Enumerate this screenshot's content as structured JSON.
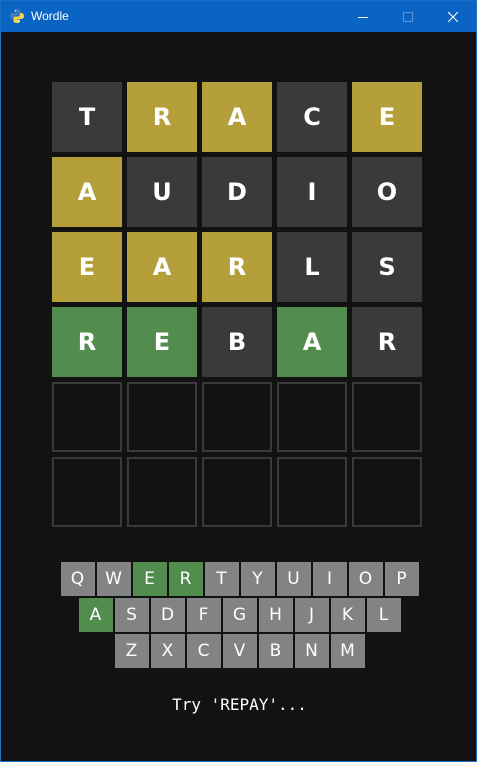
{
  "window": {
    "title": "Wordle",
    "app_icon": "python-icon"
  },
  "colors": {
    "background": "#121212",
    "absent": "#3a3a3c",
    "present": "#b59f3b",
    "correct": "#538d4e",
    "empty_border": "#3a3a3c",
    "key_default": "#818384",
    "titlebar": "#0a64c4"
  },
  "board": {
    "rows": [
      [
        {
          "letter": "T",
          "state": "absent"
        },
        {
          "letter": "R",
          "state": "present"
        },
        {
          "letter": "A",
          "state": "present"
        },
        {
          "letter": "C",
          "state": "absent"
        },
        {
          "letter": "E",
          "state": "present"
        }
      ],
      [
        {
          "letter": "A",
          "state": "present"
        },
        {
          "letter": "U",
          "state": "absent"
        },
        {
          "letter": "D",
          "state": "absent"
        },
        {
          "letter": "I",
          "state": "absent"
        },
        {
          "letter": "O",
          "state": "absent"
        }
      ],
      [
        {
          "letter": "E",
          "state": "present"
        },
        {
          "letter": "A",
          "state": "present"
        },
        {
          "letter": "R",
          "state": "present"
        },
        {
          "letter": "L",
          "state": "absent"
        },
        {
          "letter": "S",
          "state": "absent"
        }
      ],
      [
        {
          "letter": "R",
          "state": "correct"
        },
        {
          "letter": "E",
          "state": "correct"
        },
        {
          "letter": "B",
          "state": "absent"
        },
        {
          "letter": "A",
          "state": "correct"
        },
        {
          "letter": "R",
          "state": "absent"
        }
      ],
      [
        {
          "letter": "",
          "state": "empty"
        },
        {
          "letter": "",
          "state": "empty"
        },
        {
          "letter": "",
          "state": "empty"
        },
        {
          "letter": "",
          "state": "empty"
        },
        {
          "letter": "",
          "state": "empty"
        }
      ],
      [
        {
          "letter": "",
          "state": "empty"
        },
        {
          "letter": "",
          "state": "empty"
        },
        {
          "letter": "",
          "state": "empty"
        },
        {
          "letter": "",
          "state": "empty"
        },
        {
          "letter": "",
          "state": "empty"
        }
      ]
    ]
  },
  "keyboard": {
    "rows": [
      [
        {
          "key": "Q",
          "state": "absent"
        },
        {
          "key": "W",
          "state": "absent"
        },
        {
          "key": "E",
          "state": "correct"
        },
        {
          "key": "R",
          "state": "correct"
        },
        {
          "key": "T",
          "state": "absent"
        },
        {
          "key": "Y",
          "state": "absent"
        },
        {
          "key": "U",
          "state": "absent"
        },
        {
          "key": "I",
          "state": "absent"
        },
        {
          "key": "O",
          "state": "absent"
        },
        {
          "key": "P",
          "state": "absent"
        }
      ],
      [
        {
          "key": "A",
          "state": "correct"
        },
        {
          "key": "S",
          "state": "absent"
        },
        {
          "key": "D",
          "state": "absent"
        },
        {
          "key": "F",
          "state": "absent"
        },
        {
          "key": "G",
          "state": "absent"
        },
        {
          "key": "H",
          "state": "absent"
        },
        {
          "key": "J",
          "state": "absent"
        },
        {
          "key": "K",
          "state": "absent"
        },
        {
          "key": "L",
          "state": "absent"
        }
      ],
      [
        {
          "key": "Z",
          "state": "absent"
        },
        {
          "key": "X",
          "state": "absent"
        },
        {
          "key": "C",
          "state": "absent"
        },
        {
          "key": "V",
          "state": "absent"
        },
        {
          "key": "B",
          "state": "absent"
        },
        {
          "key": "N",
          "state": "absent"
        },
        {
          "key": "M",
          "state": "absent"
        }
      ]
    ]
  },
  "status": {
    "message": "Try 'REPAY'..."
  }
}
